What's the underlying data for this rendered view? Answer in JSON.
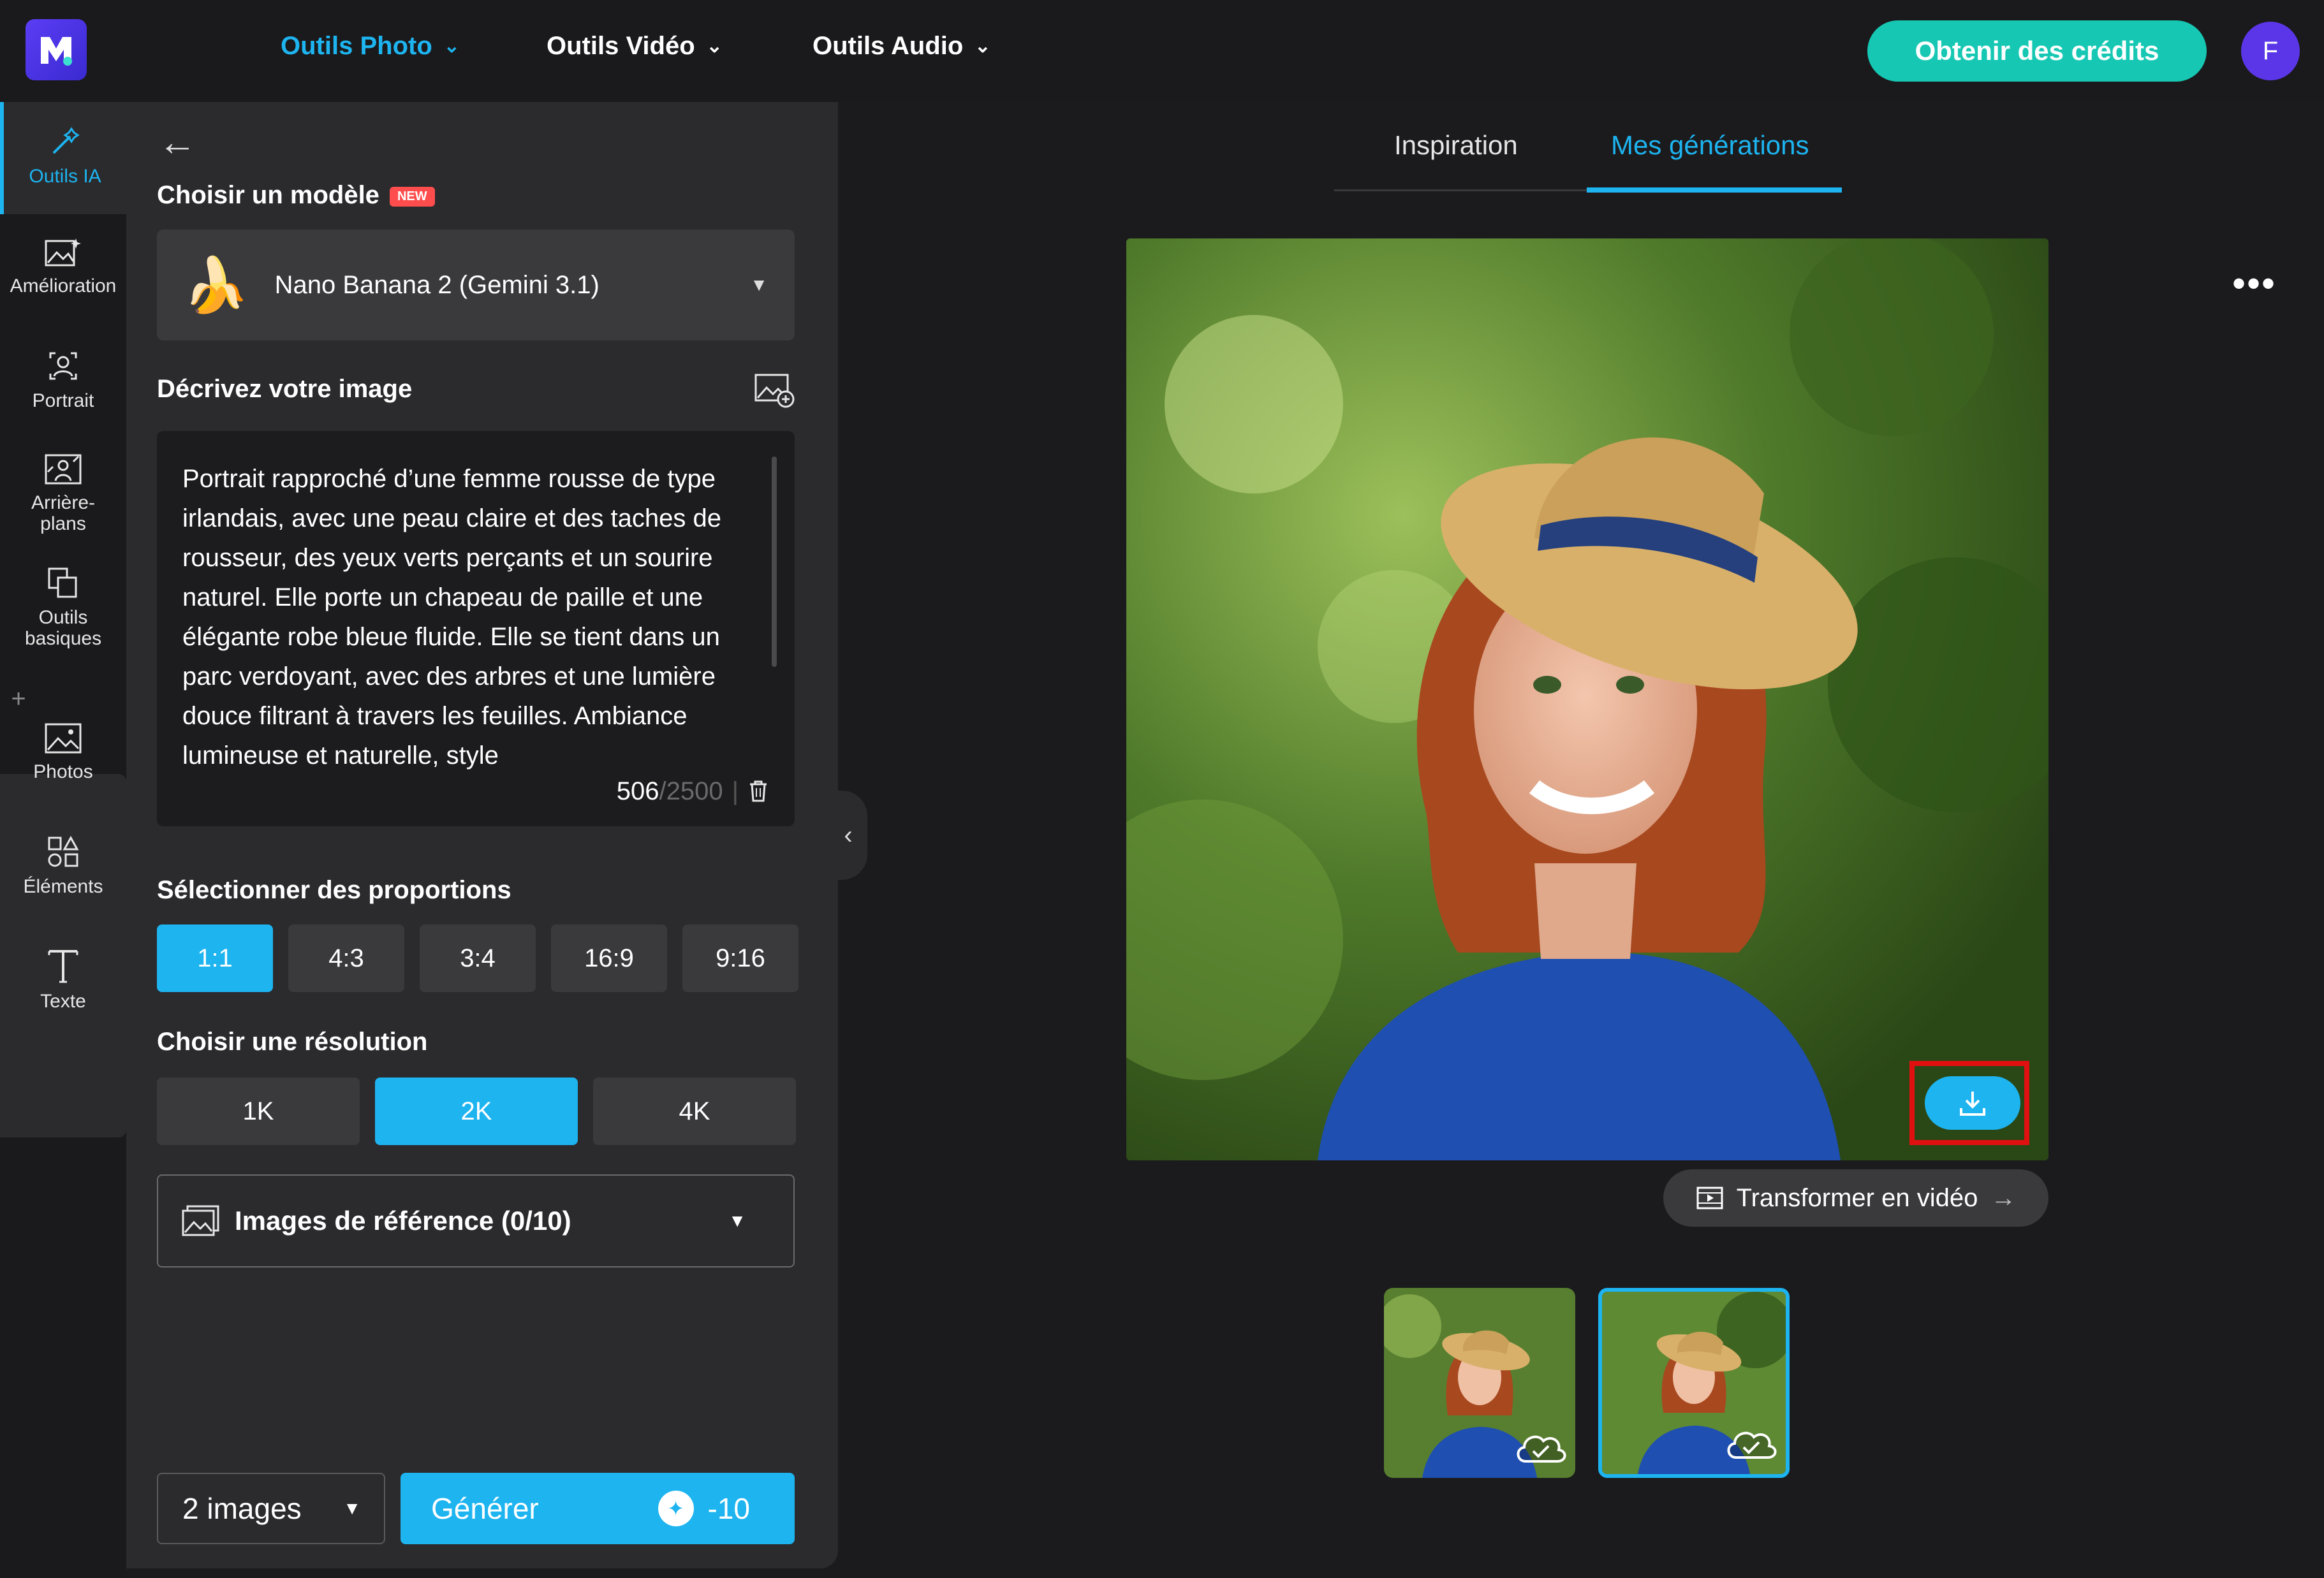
{
  "header": {
    "logo_icon": "media-io-logo-icon",
    "nav": [
      {
        "label": "Outils Photo",
        "active": true
      },
      {
        "label": "Outils Vidéo",
        "active": false
      },
      {
        "label": "Outils Audio",
        "active": false
      }
    ],
    "credits_button": "Obtenir des crédits",
    "avatar_initial": "F"
  },
  "rail": {
    "items": [
      {
        "label": "Outils IA",
        "icon": "magic-wand-icon",
        "active": true
      },
      {
        "label": "Amélioration",
        "icon": "image-enhance-icon"
      },
      {
        "label": "Portrait",
        "icon": "portrait-icon"
      },
      {
        "label": "Arrière-plans",
        "icon": "background-icon"
      },
      {
        "label": "Outils basiques",
        "icon": "copy-tools-icon"
      },
      {
        "label": "Photos",
        "icon": "photo-icon"
      },
      {
        "label": "Éléments",
        "icon": "shapes-icon"
      },
      {
        "label": "Texte",
        "icon": "text-icon"
      }
    ]
  },
  "panel": {
    "model_label": "Choisir un modèle",
    "new_badge": "NEW",
    "model_value": "Nano Banana 2 (Gemini 3.1)",
    "describe_label": "Décrivez votre image",
    "prompt_text": "Portrait rapproché d’une femme rousse de type irlandais, avec une peau claire et des taches de rousseur, des yeux verts perçants et un sourire naturel. Elle porte un chapeau de paille et une élégante robe bleue fluide. Elle se tient dans un parc verdoyant, avec des arbres et une lumière douce filtrant à travers les feuilles. Ambiance lumineuse et naturelle, style",
    "char_count": "506",
    "char_max": "/2500",
    "ratio_label": "Sélectionner des proportions",
    "ratios": [
      "1:1",
      "4:3",
      "3:4",
      "16:9",
      "9:16"
    ],
    "ratio_selected": "1:1",
    "resolution_label": "Choisir une résolution",
    "resolutions": [
      "1K",
      "2K",
      "4K"
    ],
    "resolution_selected": "2K",
    "reference_label": "Images de référence (0/10)",
    "image_count": "2 images",
    "generate_label": "Générer",
    "generate_cost": "-10"
  },
  "main": {
    "tabs": [
      {
        "label": "Inspiration",
        "active": false
      },
      {
        "label": "Mes générations",
        "active": true
      }
    ],
    "transform_video": "Transformer en vidéo",
    "colors": {
      "accent": "#1db4f0",
      "teal": "#16c8b3",
      "highlight": "#e01010"
    }
  }
}
